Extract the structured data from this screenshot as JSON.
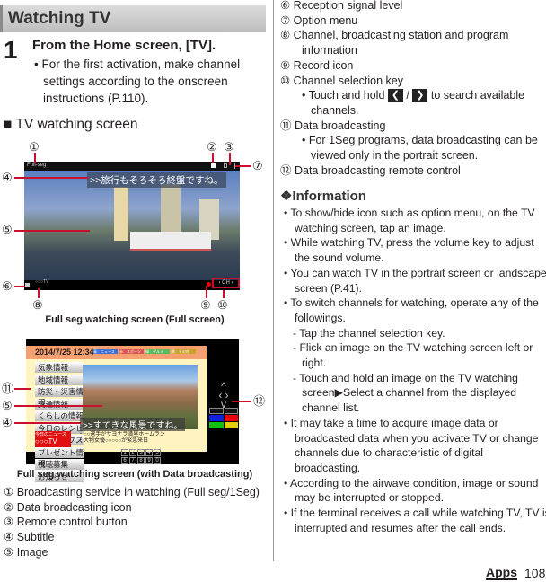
{
  "header": {
    "title": "Watching TV"
  },
  "step": {
    "number": "1",
    "title": "From the Home screen, [TV].",
    "bullet": "For the first activation, make channel settings according to the onscreen instructions (P.110)."
  },
  "section": {
    "title": "■  TV watching screen"
  },
  "screen1": {
    "label": "Full seg watching screen (Full screen)",
    "mode": "Full-seg",
    "subtitle": ">>旅行もそろそろ終盤ですね。",
    "channel_info": "○○○TV",
    "channel_key": "CH"
  },
  "screen2": {
    "label": "Full seg watching screen (with Data broadcasting)",
    "datetime": "2014/7/25  12:34",
    "tabs": [
      "青：ニュース",
      "赤：スポーツ",
      "緑：グルメ",
      "黄：その他"
    ],
    "menu": [
      "気象情報",
      "地域情報",
      "防災・災害情報",
      "交通情報",
      "くらしの情報",
      "今日のレシピ",
      "アーカイブス",
      "プレゼント情報",
      "視聴募集",
      "お知らせ"
    ],
    "subtitle": ">>すてきな風景ですね。",
    "news_label": "今日のニュース",
    "station": "○○○TV",
    "news": [
      "・○○選手がサヨナラ満塁ホームラン",
      "・大物女優○○○○○が緊急来日"
    ],
    "numpad": [
      "1",
      "2",
      "3",
      "4",
      "5",
      "6",
      "7",
      "8",
      "9",
      "0"
    ],
    "tab_colors": [
      "#3b6fd8",
      "#d9534f",
      "#5cb85c",
      "#c9a227"
    ]
  },
  "callouts": [
    "①",
    "②",
    "③",
    "④",
    "⑤",
    "⑥",
    "⑦",
    "⑧",
    "⑨",
    "⑩",
    "⑪",
    "⑫"
  ],
  "legend_left": [
    {
      "num": "①",
      "text": "Broadcasting service in watching (Full seg/1Seg)"
    },
    {
      "num": "②",
      "text": "Data broadcasting icon"
    },
    {
      "num": "③",
      "text": "Remote control button"
    },
    {
      "num": "④",
      "text": "Subtitle"
    },
    {
      "num": "⑤",
      "text": "Image"
    }
  ],
  "legend_right": {
    "i6": "⑥ Reception signal level",
    "i7": "⑦ Option menu",
    "i8a": "⑧ Channel, broadcasting station and program",
    "i8b": "information",
    "i9": "⑨ Record icon",
    "i10": "⑩ Channel selection key",
    "i10b_pre": "•  Touch and hold",
    "i10b_mid": "/",
    "i10b_post": "to search available",
    "i10c": "channels.",
    "i11": "⑪ Data broadcasting",
    "i11b": "•  For 1Seg programs, data broadcasting can be",
    "i11c": "viewed only in the portrait screen.",
    "i12": "⑫ Data broadcasting remote control"
  },
  "information": {
    "title": "❖Information",
    "lines": [
      "•  To show/hide icon such as option menu, on the TV",
      "watching screen, tap an image.",
      "•  While watching TV, press the volume key to adjust",
      "the sound volume.",
      "•  You can watch TV in the portrait screen or landscape",
      "screen (P.41).",
      "•  To switch channels for watching, operate any of the",
      "followings.",
      "-   Tap the channel selection key.",
      "-   Flick an image on the TV watching screen left or",
      "right.",
      "-   Touch and hold an image on the TV watching",
      "screen▶Select a channel from the displayed",
      "channel list.",
      "•  It may take a time to acquire image data or",
      "broadcasted data when you activate TV or change",
      "channels due to characteristic of digital",
      "broadcasting.",
      "•  According to the airwave condition, image or sound",
      "may be interrupted or stopped.",
      "•  If the terminal receives a call while watching TV, TV is",
      "interrupted and resumes after the call ends."
    ]
  },
  "footer": {
    "section": "Apps",
    "page": "108"
  },
  "colors": {
    "accent": "#c8102e"
  }
}
